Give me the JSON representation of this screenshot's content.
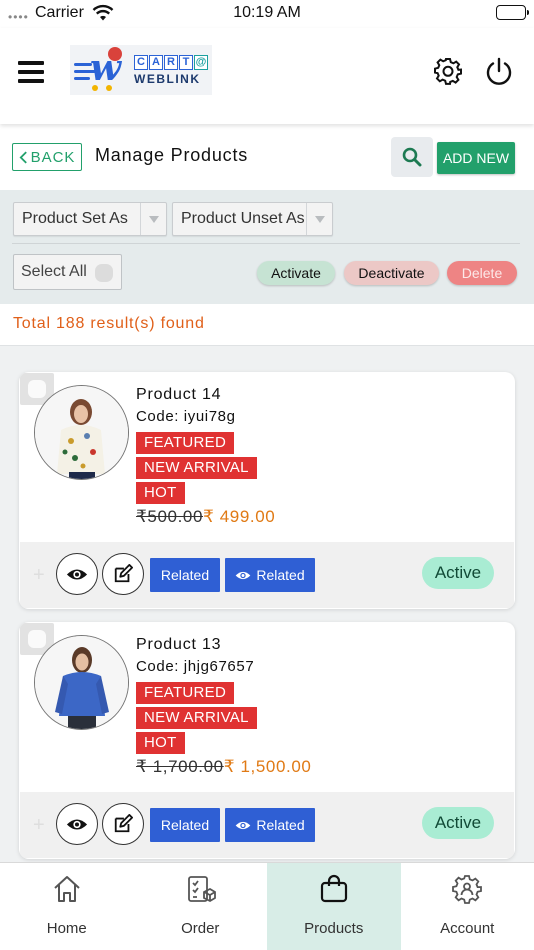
{
  "status_bar": {
    "carrier": "Carrier",
    "time": "10:19 AM"
  },
  "header": {
    "logo_text_cart": [
      "C",
      "A",
      "R",
      "T",
      "@"
    ],
    "logo_text_weblink": "WEBLINK",
    "icons": [
      "menu-icon",
      "gear-icon",
      "power-icon"
    ]
  },
  "toolbar": {
    "back_label": "BACK",
    "title": "Manage Products",
    "add_new_label": "ADD NEW"
  },
  "filters": {
    "product_set_as": "Product Set As",
    "product_unset_as": "Product Unset As",
    "select_all": "Select All",
    "activate": "Activate",
    "deactivate": "Deactivate",
    "delete": "Delete"
  },
  "results": {
    "summary": "Total 188 result(s) found"
  },
  "products": [
    {
      "name": "Product 14",
      "code": "Code: iyui78g",
      "tags": [
        "FEATURED",
        "NEW ARRIVAL",
        "HOT"
      ],
      "old_price": "₹500.00",
      "new_price": "₹ 499.00",
      "related_label": "Related",
      "related_view_label": "Related",
      "status": "Active"
    },
    {
      "name": "Product 13",
      "code": "Code: jhjg67657",
      "tags": [
        "FEATURED",
        "NEW ARRIVAL",
        "HOT"
      ],
      "old_price": "₹ 1,700.00",
      "new_price": "₹ 1,500.00",
      "related_label": "Related",
      "related_view_label": "Related",
      "status": "Active"
    }
  ],
  "tabs": [
    {
      "label": "Home",
      "icon": "home-icon",
      "active": false
    },
    {
      "label": "Order",
      "icon": "order-icon",
      "active": false
    },
    {
      "label": "Products",
      "icon": "shopping-bag-icon",
      "active": true
    },
    {
      "label": "Account",
      "icon": "account-gear-icon",
      "active": false
    }
  ],
  "colors": {
    "primary_green": "#22a06b",
    "tag_red": "#e03232",
    "price_orange": "#e07a15",
    "related_blue": "#2f5fd4",
    "active_badge": "#a9ecd3",
    "result_orange": "#e0601a"
  }
}
